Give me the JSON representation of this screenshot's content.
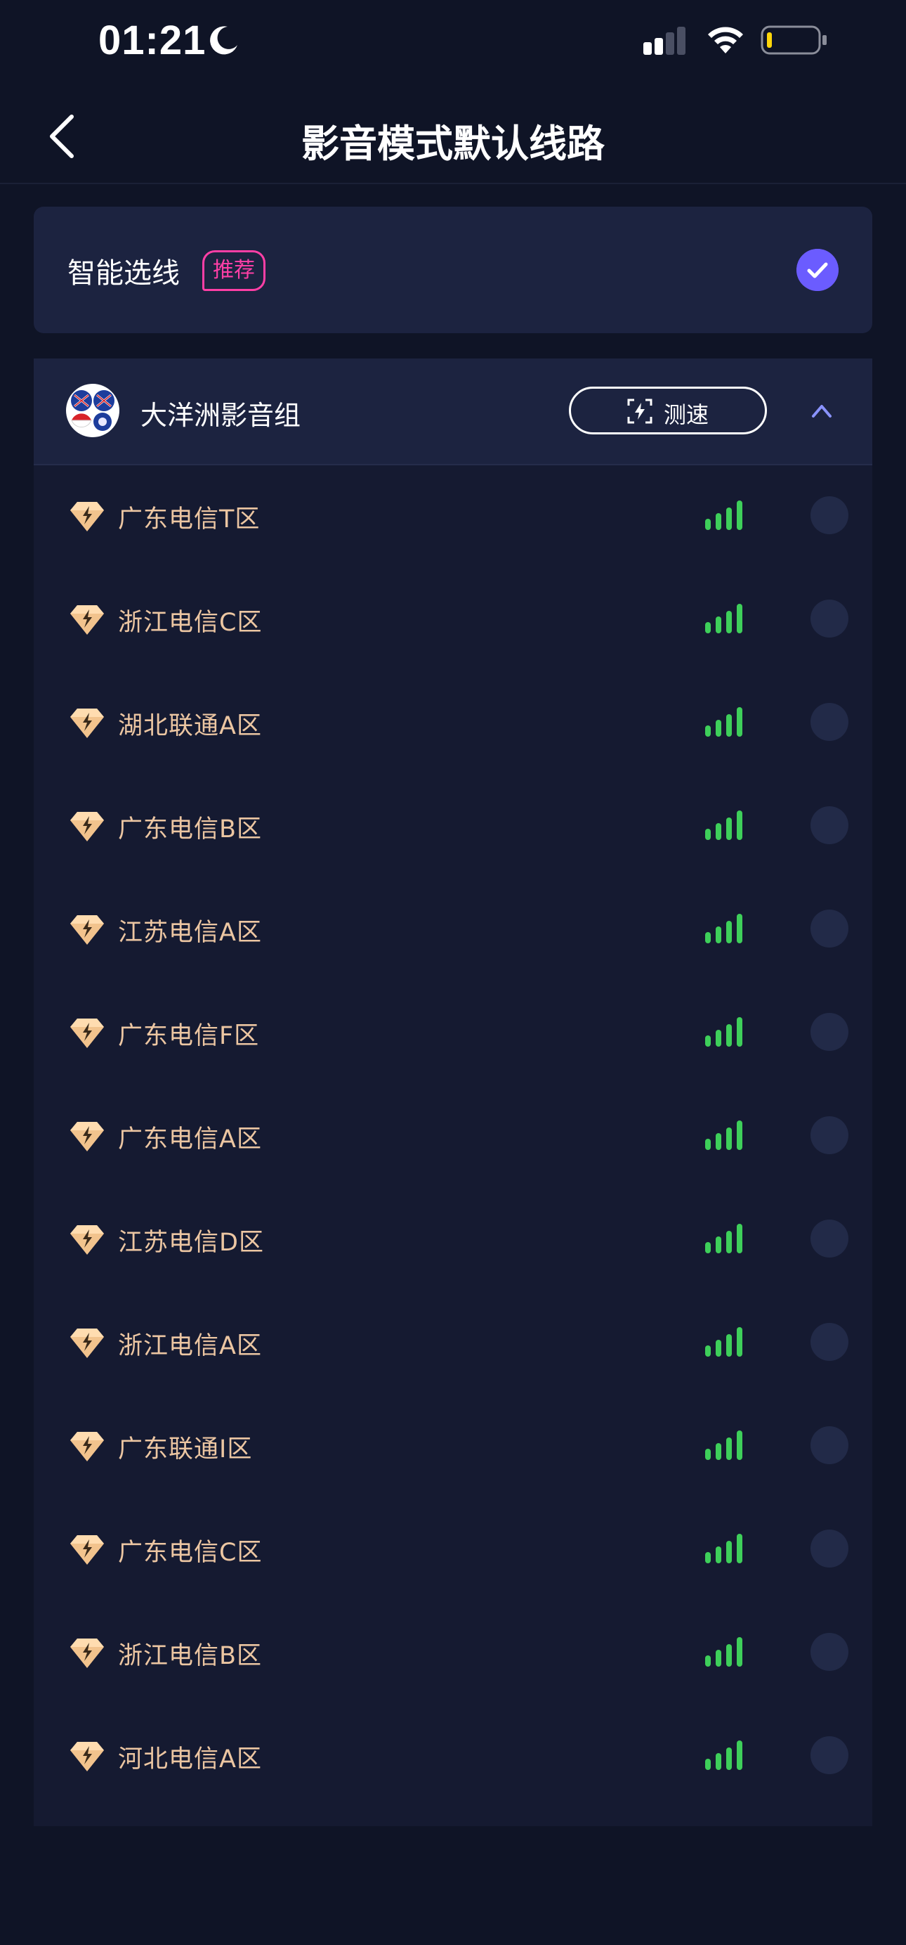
{
  "status_bar": {
    "time": "01:21",
    "icons": [
      "moon-icon",
      "cellular-signal-icon",
      "wifi-icon",
      "battery-icon"
    ]
  },
  "nav": {
    "title": "影音模式默认线路",
    "back_icon": "chevron-left-icon"
  },
  "smart_select": {
    "label": "智能选线",
    "badge": "推荐",
    "selected": true,
    "accent": "#6b5cff"
  },
  "group": {
    "title": "大洋洲影音组",
    "speed_test_label": "测速",
    "expanded": true,
    "servers": [
      {
        "name": "广东电信T区",
        "signal": 4
      },
      {
        "name": "浙江电信C区",
        "signal": 4
      },
      {
        "name": "湖北联通A区",
        "signal": 4
      },
      {
        "name": "广东电信B区",
        "signal": 4
      },
      {
        "name": "江苏电信A区",
        "signal": 4
      },
      {
        "name": "广东电信F区",
        "signal": 4
      },
      {
        "name": "广东电信A区",
        "signal": 4
      },
      {
        "name": "江苏电信D区",
        "signal": 4
      },
      {
        "name": "浙江电信A区",
        "signal": 4
      },
      {
        "name": "广东联通I区",
        "signal": 4
      },
      {
        "name": "广东电信C区",
        "signal": 4
      },
      {
        "name": "浙江电信B区",
        "signal": 4
      },
      {
        "name": "河北电信A区",
        "signal": 4
      }
    ]
  },
  "colors": {
    "background": "#0f1426",
    "card": "#1c2340",
    "signal": "#3ecf5a",
    "server_text": "#ecc6a2",
    "badge": "#ff3fa6"
  }
}
